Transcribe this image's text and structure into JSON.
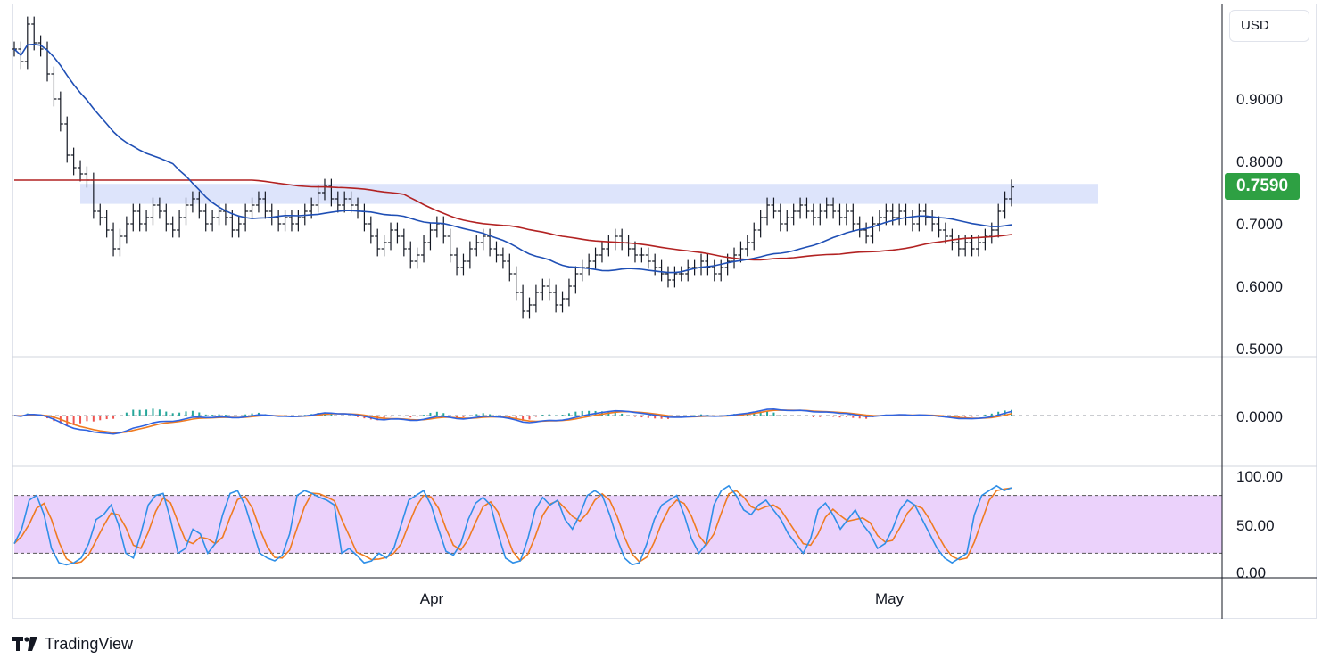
{
  "header": {
    "currency": "USD"
  },
  "price_badge": {
    "value": "0.7590",
    "color": "#2ea043"
  },
  "brand": {
    "name": "TradingView",
    "logo_icon": "tradingview-logo-icon"
  },
  "colors": {
    "ma_fast": "#1f4fb5",
    "ma_slow": "#b22222",
    "zone": "#dde4fb",
    "macd_line": "#2f63e0",
    "signal_line": "#ef7b21",
    "hist_pos": "#26a69a",
    "hist_neg": "#ef5350",
    "stoch_k": "#2f8fe8",
    "stoch_d": "#ef7b21",
    "stoch_band": "#ebd2fb"
  },
  "chart_data": [
    {
      "type": "candlestick",
      "title": "",
      "y_ticks": [
        "0.9000",
        "0.8000",
        "0.7000",
        "0.6000",
        "0.5000"
      ],
      "ylim": [
        0.49,
        1.05
      ],
      "x_labels": [
        "Apr",
        "May"
      ],
      "last_price": 0.759,
      "resistance_zone": [
        0.732,
        0.764
      ],
      "close": [
        0.98,
        0.96,
        1.02,
        0.99,
        0.98,
        0.94,
        0.9,
        0.86,
        0.81,
        0.79,
        0.78,
        0.77,
        0.72,
        0.71,
        0.69,
        0.66,
        0.68,
        0.7,
        0.72,
        0.7,
        0.71,
        0.73,
        0.72,
        0.7,
        0.69,
        0.71,
        0.73,
        0.74,
        0.72,
        0.7,
        0.71,
        0.72,
        0.71,
        0.69,
        0.7,
        0.72,
        0.73,
        0.74,
        0.72,
        0.71,
        0.7,
        0.71,
        0.7,
        0.71,
        0.72,
        0.73,
        0.75,
        0.76,
        0.74,
        0.73,
        0.74,
        0.73,
        0.72,
        0.7,
        0.68,
        0.66,
        0.67,
        0.69,
        0.68,
        0.66,
        0.64,
        0.65,
        0.67,
        0.69,
        0.7,
        0.68,
        0.65,
        0.63,
        0.64,
        0.66,
        0.67,
        0.68,
        0.66,
        0.65,
        0.64,
        0.62,
        0.59,
        0.56,
        0.57,
        0.59,
        0.6,
        0.59,
        0.57,
        0.58,
        0.6,
        0.62,
        0.63,
        0.64,
        0.65,
        0.66,
        0.67,
        0.68,
        0.67,
        0.66,
        0.65,
        0.65,
        0.64,
        0.63,
        0.62,
        0.61,
        0.62,
        0.62,
        0.63,
        0.63,
        0.64,
        0.63,
        0.62,
        0.63,
        0.64,
        0.65,
        0.66,
        0.67,
        0.69,
        0.71,
        0.73,
        0.72,
        0.7,
        0.71,
        0.72,
        0.73,
        0.72,
        0.71,
        0.72,
        0.73,
        0.72,
        0.71,
        0.72,
        0.7,
        0.69,
        0.68,
        0.7,
        0.71,
        0.72,
        0.71,
        0.72,
        0.71,
        0.7,
        0.72,
        0.71,
        0.7,
        0.69,
        0.68,
        0.67,
        0.66,
        0.67,
        0.66,
        0.67,
        0.68,
        0.69,
        0.72,
        0.74,
        0.759
      ],
      "series": [
        {
          "name": "",
          "role": "ma_fast"
        },
        {
          "name": "",
          "role": "ma_slow"
        }
      ]
    },
    {
      "type": "line",
      "title": "",
      "y_ticks": [
        "0.0000"
      ],
      "zero_line": 0.0,
      "note": "MACD panel: macd line, signal line and histogram"
    },
    {
      "type": "line",
      "title": "",
      "y_ticks": [
        "100.00",
        "50.00",
        "0.00"
      ],
      "ylim": [
        0,
        100
      ],
      "band": [
        20,
        80
      ],
      "k": [
        30,
        45,
        75,
        80,
        60,
        25,
        10,
        8,
        10,
        15,
        30,
        55,
        60,
        70,
        50,
        20,
        15,
        40,
        70,
        80,
        82,
        55,
        20,
        25,
        45,
        40,
        20,
        30,
        60,
        82,
        85,
        70,
        45,
        20,
        15,
        12,
        18,
        40,
        80,
        85,
        82,
        78,
        75,
        70,
        20,
        25,
        18,
        10,
        12,
        20,
        15,
        25,
        50,
        75,
        80,
        85,
        70,
        45,
        22,
        18,
        30,
        55,
        72,
        78,
        70,
        40,
        15,
        10,
        12,
        35,
        65,
        78,
        70,
        75,
        55,
        45,
        60,
        80,
        85,
        80,
        60,
        35,
        15,
        8,
        10,
        30,
        55,
        70,
        75,
        80,
        60,
        35,
        20,
        30,
        70,
        85,
        90,
        80,
        65,
        60,
        70,
        75,
        65,
        55,
        40,
        30,
        20,
        35,
        65,
        72,
        60,
        45,
        55,
        65,
        50,
        40,
        25,
        30,
        45,
        65,
        75,
        70,
        55,
        40,
        25,
        15,
        10,
        15,
        20,
        60,
        80,
        85,
        90,
        85,
        88
      ]
    }
  ]
}
